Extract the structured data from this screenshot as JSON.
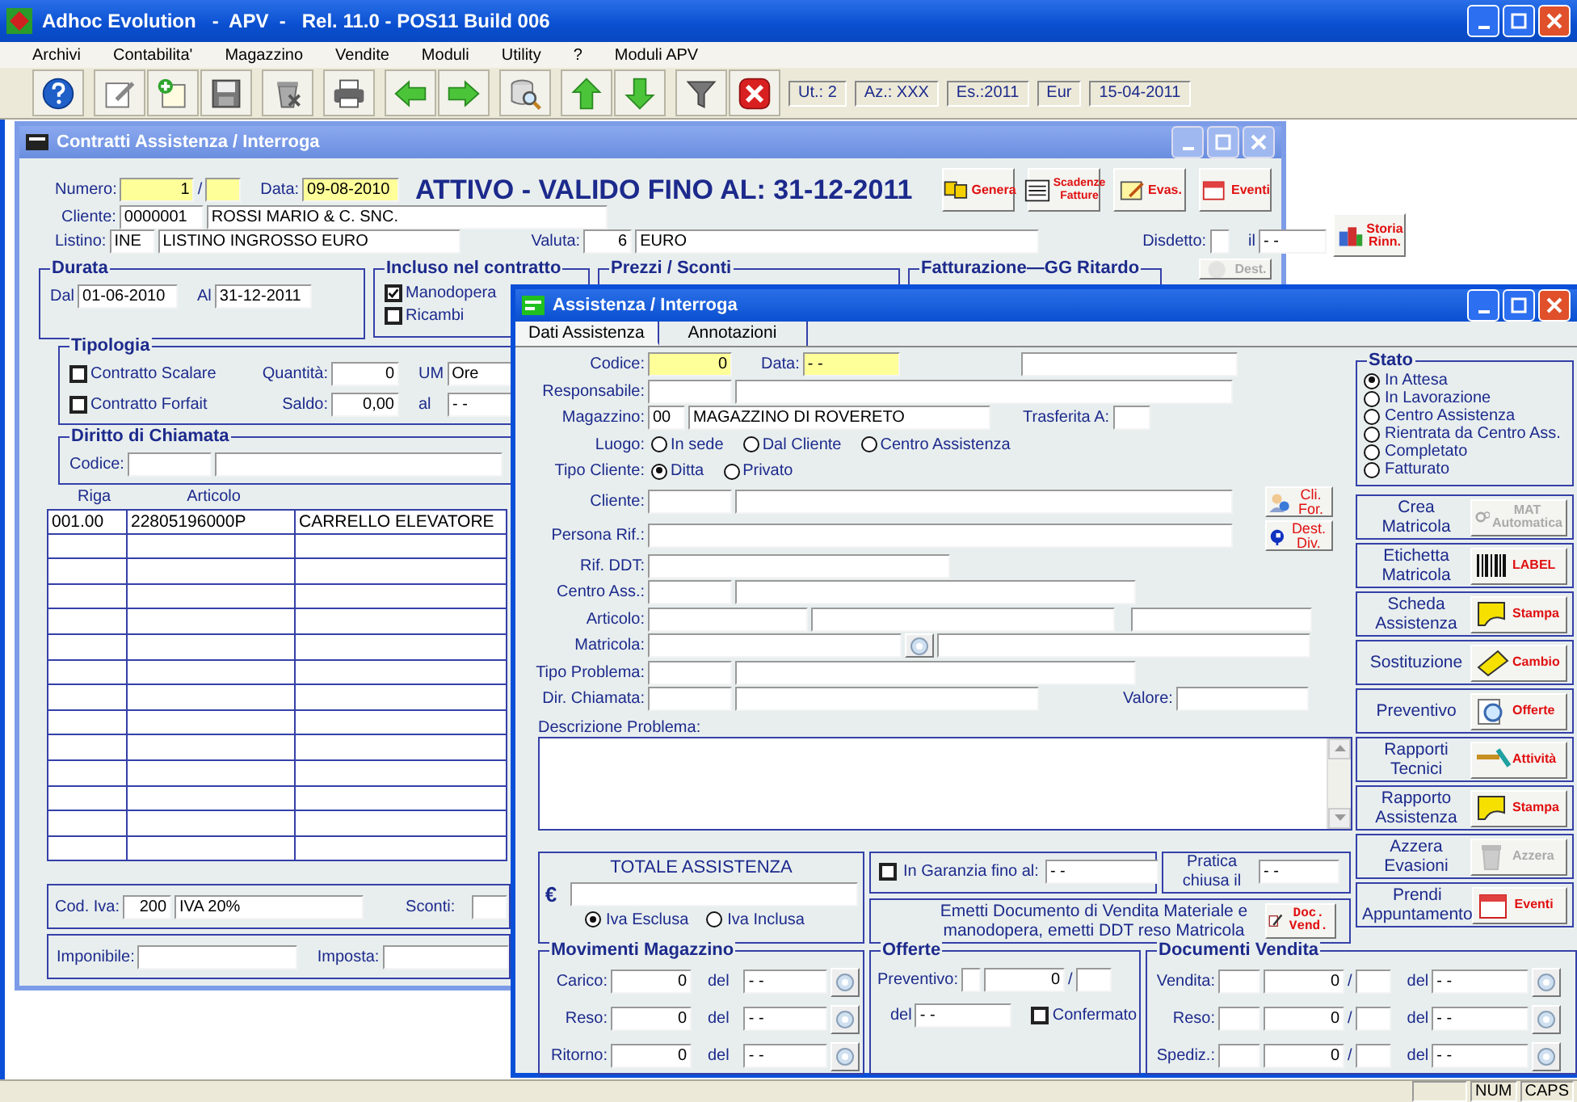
{
  "app": {
    "title": "Adhoc Evolution   -  APV  -   Rel. 11.0 - POS11 Build 006",
    "menu": [
      "Archivi",
      "Contabilita'",
      "Magazzino",
      "Vendite",
      "Moduli",
      "Utility",
      "?",
      "Moduli APV"
    ],
    "info": [
      "Ut.: 2",
      "Az.: XXX",
      "Es.:2011",
      "Eur",
      "15-04-2011"
    ]
  },
  "contract": {
    "title": "Contratti Assistenza / Interroga",
    "numero": {
      "label": "Numero:",
      "value": "1",
      "separator": "/",
      "required": true
    },
    "data": {
      "label": "Data:",
      "value": "09-08-2010",
      "required": true
    },
    "status": "ATTIVO - VALIDO FINO AL: 31-12-2011",
    "buttons": [
      {
        "label": "Genera",
        "disabled": false
      },
      {
        "label": "Scadenze Fatture",
        "disabled": false
      },
      {
        "label": "Evas.",
        "disabled": false
      },
      {
        "label": "Eventi",
        "disabled": false
      },
      {
        "label": "Storia Rinn.",
        "disabled": false
      },
      {
        "label": "Dest.",
        "disabled": true
      }
    ],
    "cliente": {
      "label": "Cliente:",
      "code": "0000001",
      "name": "ROSSI MARIO & C. SNC."
    },
    "listino": {
      "label": "Listino:",
      "code": "INE",
      "name": "LISTINO INGROSSO EURO"
    },
    "valuta": {
      "label": "Valuta:",
      "code": "6",
      "name": "EURO"
    },
    "disdetto": {
      "label": "Disdetto:",
      "il_label": "il",
      "date": "- -"
    },
    "durata": {
      "title": "Durata",
      "dal_label": "Dal",
      "dal": "01-06-2010",
      "al_label": "Al",
      "al": "31-12-2011"
    },
    "incluso": {
      "title": "Incluso nel contratto",
      "items": [
        {
          "label": "Manodopera",
          "checked": true
        },
        {
          "label": "Ricambi",
          "checked": false
        }
      ]
    },
    "prezzi": {
      "title": "Prezzi / Sconti"
    },
    "fatturazione": {
      "title": "Fatturazione—GG Ritardo"
    },
    "tipologia": {
      "title": "Tipologia",
      "items": [
        {
          "label": "Contratto Scalare",
          "checked": false
        },
        {
          "label": "Contratto Forfait",
          "checked": false
        }
      ],
      "quantita_label": "Quantità:",
      "quantita": "0",
      "um_label": "UM",
      "um": "Ore",
      "saldo_label": "Saldo:",
      "saldo": "0,00",
      "al_label": "al",
      "al": "- -"
    },
    "diritto": {
      "title": "Diritto di Chiamata",
      "codice_label": "Codice:"
    },
    "table": {
      "columns": [
        "Riga",
        "Articolo"
      ],
      "rows": [
        [
          "001.00",
          "22805196000P",
          "CARRELLO ELEVATORE"
        ]
      ]
    },
    "iva": {
      "label": "Cod. Iva:",
      "code": "200",
      "name": "IVA 20%",
      "sconti_label": "Sconti:"
    },
    "totali": {
      "imponibile_label": "Imponibile:",
      "imposta_label": "Imposta:"
    }
  },
  "assist": {
    "title": "Assistenza / Interroga",
    "tabs": [
      {
        "label": "Dati Assistenza",
        "selected": true
      },
      {
        "label": "Annotazioni",
        "selected": false
      }
    ],
    "rows": [
      {
        "label": "Codice:",
        "items": [
          {
            "kind": "field",
            "value": "0",
            "required": true
          },
          {
            "kind": "label",
            "text": "Data:"
          },
          {
            "kind": "field",
            "value": "- -",
            "required": true
          },
          {
            "kind": "field",
            "required": false
          }
        ]
      },
      {
        "label": "Responsabile:",
        "items": [
          {
            "kind": "field",
            "required": false
          },
          {
            "kind": "field",
            "required": false
          }
        ]
      },
      {
        "label": "Magazzino:",
        "items": [
          {
            "kind": "field",
            "value": "00",
            "required": false
          },
          {
            "kind": "field",
            "value": "MAGAZZINO DI ROVERETO",
            "required": false
          },
          {
            "kind": "label",
            "text": "Trasferita A:"
          },
          {
            "kind": "field",
            "required": false
          }
        ]
      },
      {
        "label": "Luogo:",
        "items": [
          {
            "kind": "radio",
            "label": "In sede",
            "selected": false
          },
          {
            "kind": "radio",
            "label": "Dal Cliente",
            "selected": false
          },
          {
            "kind": "radio",
            "label": "Centro Assistenza",
            "selected": false
          }
        ]
      },
      {
        "label": "Tipo Cliente:",
        "items": [
          {
            "kind": "radio",
            "label": "Ditta",
            "selected": true
          },
          {
            "kind": "radio",
            "label": "Privato",
            "selected": false
          }
        ]
      },
      {
        "label": "Cliente:",
        "items": [
          {
            "kind": "field",
            "required": false
          },
          {
            "kind": "field",
            "required": false
          },
          {
            "kind": "button",
            "label": "Cli. For."
          }
        ]
      },
      {
        "label": "Persona Rif.:",
        "items": [
          {
            "kind": "field",
            "required": false
          },
          {
            "kind": "button",
            "label": "Dest. Div."
          }
        ]
      },
      {
        "label": "Rif. DDT:",
        "items": [
          {
            "kind": "field",
            "required": false
          }
        ]
      },
      {
        "label": "Centro Ass.:",
        "items": [
          {
            "kind": "field",
            "required": false
          },
          {
            "kind": "field",
            "required": false
          }
        ]
      },
      {
        "label": "Articolo:",
        "items": [
          {
            "kind": "field",
            "required": false
          },
          {
            "kind": "field",
            "required": false
          },
          {
            "kind": "field",
            "required": false
          }
        ]
      },
      {
        "label": "Matricola:",
        "items": [
          {
            "kind": "field",
            "required": false
          },
          {
            "kind": "lookup"
          },
          {
            "kind": "field",
            "required": false
          }
        ]
      },
      {
        "label": "Tipo Problema:",
        "items": [
          {
            "kind": "field",
            "required": false
          },
          {
            "kind": "field",
            "required": false
          }
        ]
      },
      {
        "label": "Dir. Chiamata:",
        "items": [
          {
            "kind": "field",
            "required": false
          },
          {
            "kind": "field",
            "required": false
          },
          {
            "kind": "label",
            "text": "Valore:"
          },
          {
            "kind": "field",
            "required": false
          }
        ]
      }
    ],
    "descrizione": {
      "label": "Descrizione Problema:"
    },
    "stato": {
      "title": "Stato",
      "options": [
        {
          "label": "In Attesa",
          "selected": true
        },
        {
          "label": "In Lavorazione",
          "selected": false
        },
        {
          "label": "Centro Assistenza",
          "selected": false
        },
        {
          "label": "Rientrata da Centro Ass.",
          "selected": false
        },
        {
          "label": "Completato",
          "selected": false
        },
        {
          "label": "Fatturato",
          "selected": false
        }
      ]
    },
    "actions": [
      {
        "label": "Crea Matricola",
        "icon_text": "MAT Automatica",
        "disabled": true
      },
      {
        "label": "Etichetta Matricola",
        "icon_text": "LABEL",
        "disabled": false
      },
      {
        "label": "Scheda Assistenza",
        "icon_text": "Stampa",
        "disabled": false
      },
      {
        "label": "Sostituzione",
        "icon_text": "Cambio",
        "disabled": false
      },
      {
        "label": "Preventivo",
        "icon_text": "Offerte",
        "disabled": false
      },
      {
        "label": "Rapporti Tecnici",
        "icon_text": "Attività",
        "disabled": false
      },
      {
        "label": "Rapporto Assistenza",
        "icon_text": "Stampa",
        "disabled": false
      },
      {
        "label": "Azzera Evasioni",
        "icon_text": "Azzera",
        "disabled": true
      },
      {
        "label": "Prendi Appuntamento",
        "icon_text": "Eventi",
        "disabled": false
      }
    ],
    "totale": {
      "title": "TOTALE ASSISTENZA",
      "currency": "€",
      "iva": [
        {
          "label": "Iva Esclusa",
          "selected": true
        },
        {
          "label": "Iva Inclusa",
          "selected": false
        }
      ]
    },
    "garanzia": {
      "label": "In Garanzia fino al:",
      "checked": false,
      "date": "- -"
    },
    "pratica": {
      "label": "Pratica chiusa il",
      "date": "- -"
    },
    "emetti": {
      "text": "Emetti Documento di Vendita Materiale e manodopera, emetti DDT reso Matricola",
      "button": "Doc. Vend."
    },
    "movimenti": {
      "title": "Movimenti Magazzino",
      "rows": [
        {
          "label": "Carico:",
          "value": "0",
          "del_label": "del",
          "date": "- -"
        },
        {
          "label": "Reso:",
          "value": "0",
          "del_label": "del",
          "date": "- -"
        },
        {
          "label": "Ritorno:",
          "value": "0",
          "del_label": "del",
          "date": "- -"
        }
      ]
    },
    "offerte": {
      "title": "Offerte",
      "preventivo_label": "Preventivo:",
      "number": "0",
      "separator": "/",
      "del_label": "del",
      "date": "- -",
      "confermato": {
        "label": "Confermato",
        "checked": false
      }
    },
    "documenti": {
      "title": "Documenti Vendita",
      "rows": [
        {
          "label": "Vendita:",
          "number": "0",
          "separator": "/",
          "del_label": "del",
          "date": "- -"
        },
        {
          "label": "Reso:",
          "number": "0",
          "separator": "/",
          "del_label": "del",
          "date": "- -"
        },
        {
          "label": "Spediz.:",
          "number": "0",
          "separator": "/",
          "del_label": "del",
          "date": "- -"
        }
      ]
    }
  },
  "status_bar": [
    "NUM",
    "CAPS"
  ]
}
